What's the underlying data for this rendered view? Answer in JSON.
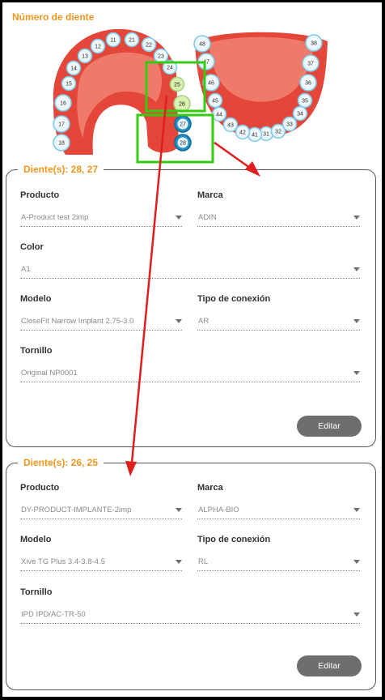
{
  "section_title": "Número de diente",
  "teeth": {
    "upper": [
      "11",
      "12",
      "13",
      "14",
      "15",
      "16",
      "17",
      "18",
      "21",
      "22",
      "23",
      "24",
      "25",
      "26",
      "27",
      "28"
    ],
    "lower": [
      "31",
      "32",
      "33",
      "34",
      "35",
      "36",
      "37",
      "38",
      "41",
      "42",
      "43",
      "44",
      "45",
      "46",
      "47",
      "48"
    ],
    "selected_light_green": [
      "25",
      "26"
    ],
    "selected_blue": [
      "27",
      "28"
    ]
  },
  "panels": [
    {
      "legend": "Diente(s): 28, 27",
      "producto_label": "Producto",
      "producto_value": "A-Product test 2imp",
      "marca_label": "Marca",
      "marca_value": "ADIN",
      "color_label": "Color",
      "color_value": "A1",
      "modelo_label": "Modelo",
      "modelo_value": "CloseFit Narrow Implant 2.75-3.0",
      "conexion_label": "Tipo de conexión",
      "conexion_value": "AR",
      "tornillo_label": "Tornillo",
      "tornillo_value": "Original NP0001",
      "edit_label": "Editar"
    },
    {
      "legend": "Diente(s): 26, 25",
      "producto_label": "Producto",
      "producto_value": "DY-PRODUCT-IMPLANTE-2imp",
      "marca_label": "Marca",
      "marca_value": "ALPHA-BIO",
      "modelo_label": "Modelo",
      "modelo_value": "Xive TG Plus 3.4-3.8-4.5",
      "conexion_label": "Tipo de conexión",
      "conexion_value": "RL",
      "tornillo_label": "Tornillo",
      "tornillo_value": "IPD IPD/AC-TR-50",
      "edit_label": "Editar"
    }
  ],
  "colors": {
    "accent": "#f0961e",
    "gum": "#e5463a",
    "tooth_outline": "#7ec8ea",
    "selected_blue": "#1f8fc4",
    "selected_green": "#d8f0b0",
    "highlight_box": "#33cc11",
    "arrow": "#e01e1e"
  }
}
